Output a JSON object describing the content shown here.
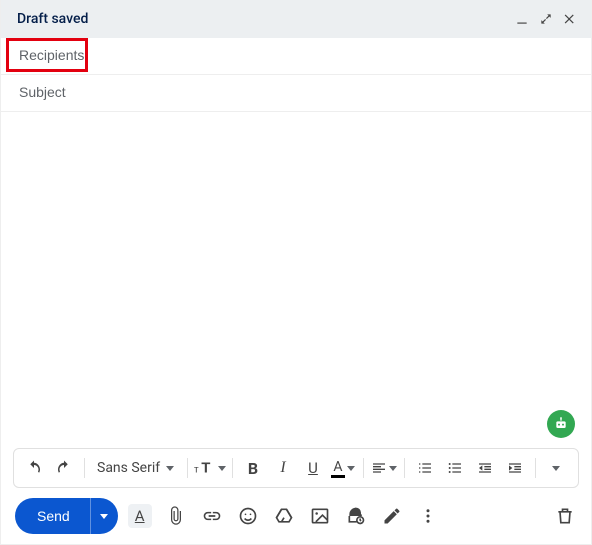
{
  "header": {
    "title": "Draft saved"
  },
  "fields": {
    "recipients_placeholder": "Recipients",
    "subject_placeholder": "Subject",
    "body_value": ""
  },
  "format_toolbar": {
    "font_family": "Sans Serif",
    "size_label": "tT",
    "bold": "B",
    "italic": "I",
    "underline": "U",
    "text_color": "A"
  },
  "actions": {
    "send_label": "Send"
  },
  "colors": {
    "primary": "#0b57d0",
    "highlight_border": "#e3000f"
  }
}
